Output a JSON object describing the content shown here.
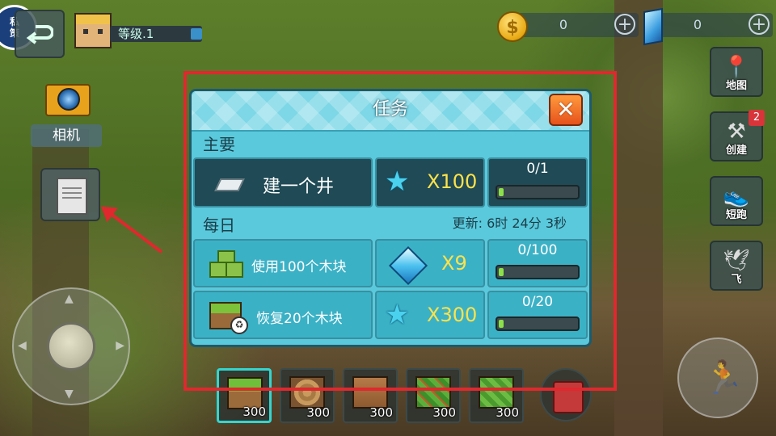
{
  "top_left": {
    "privacy_label": "私\n策",
    "level_text": "等级.1"
  },
  "camera": {
    "label": "相机"
  },
  "currency": {
    "coins": "0",
    "gems": "0",
    "coin_symbol": "$",
    "plus": "+"
  },
  "side_menu": [
    {
      "label": "地图",
      "icon": "map-pin-icon",
      "badge": ""
    },
    {
      "label": "创建",
      "icon": "hammer-icon",
      "badge": "2"
    },
    {
      "label": "短跑",
      "icon": "sneaker-icon",
      "badge": ""
    },
    {
      "label": "飞",
      "icon": "wing-icon",
      "badge": ""
    }
  ],
  "dialog": {
    "title": "任务",
    "close_symbol": "✕",
    "main_section": "主要",
    "daily_section": "每日",
    "refresh_text": "更新: 6时 24分 3秒",
    "main_tasks": [
      {
        "name": "建一个井",
        "reward": "X100",
        "reward_type": "star",
        "progress_text": "0/1",
        "progress": 0.0
      }
    ],
    "daily_tasks": [
      {
        "name": "使用100个木块",
        "reward": "X9",
        "reward_type": "gem",
        "progress_text": "0/100",
        "progress": 0.0
      },
      {
        "name": "恢复20个木块",
        "reward": "X300",
        "reward_type": "star",
        "progress_text": "0/20",
        "progress": 0.0
      }
    ]
  },
  "hotbar": [
    {
      "block": "grass-block",
      "count": "300",
      "selected": true
    },
    {
      "block": "oak-log",
      "count": "300",
      "selected": false
    },
    {
      "block": "wood-plank",
      "count": "300",
      "selected": false
    },
    {
      "block": "leaves-block",
      "count": "300",
      "selected": false
    },
    {
      "block": "leaves-block",
      "count": "300",
      "selected": false
    }
  ],
  "colors": {
    "dialog_bg": "#5ac9dc",
    "highlight": "#e0282e",
    "reward_text": "#ffe24a"
  }
}
